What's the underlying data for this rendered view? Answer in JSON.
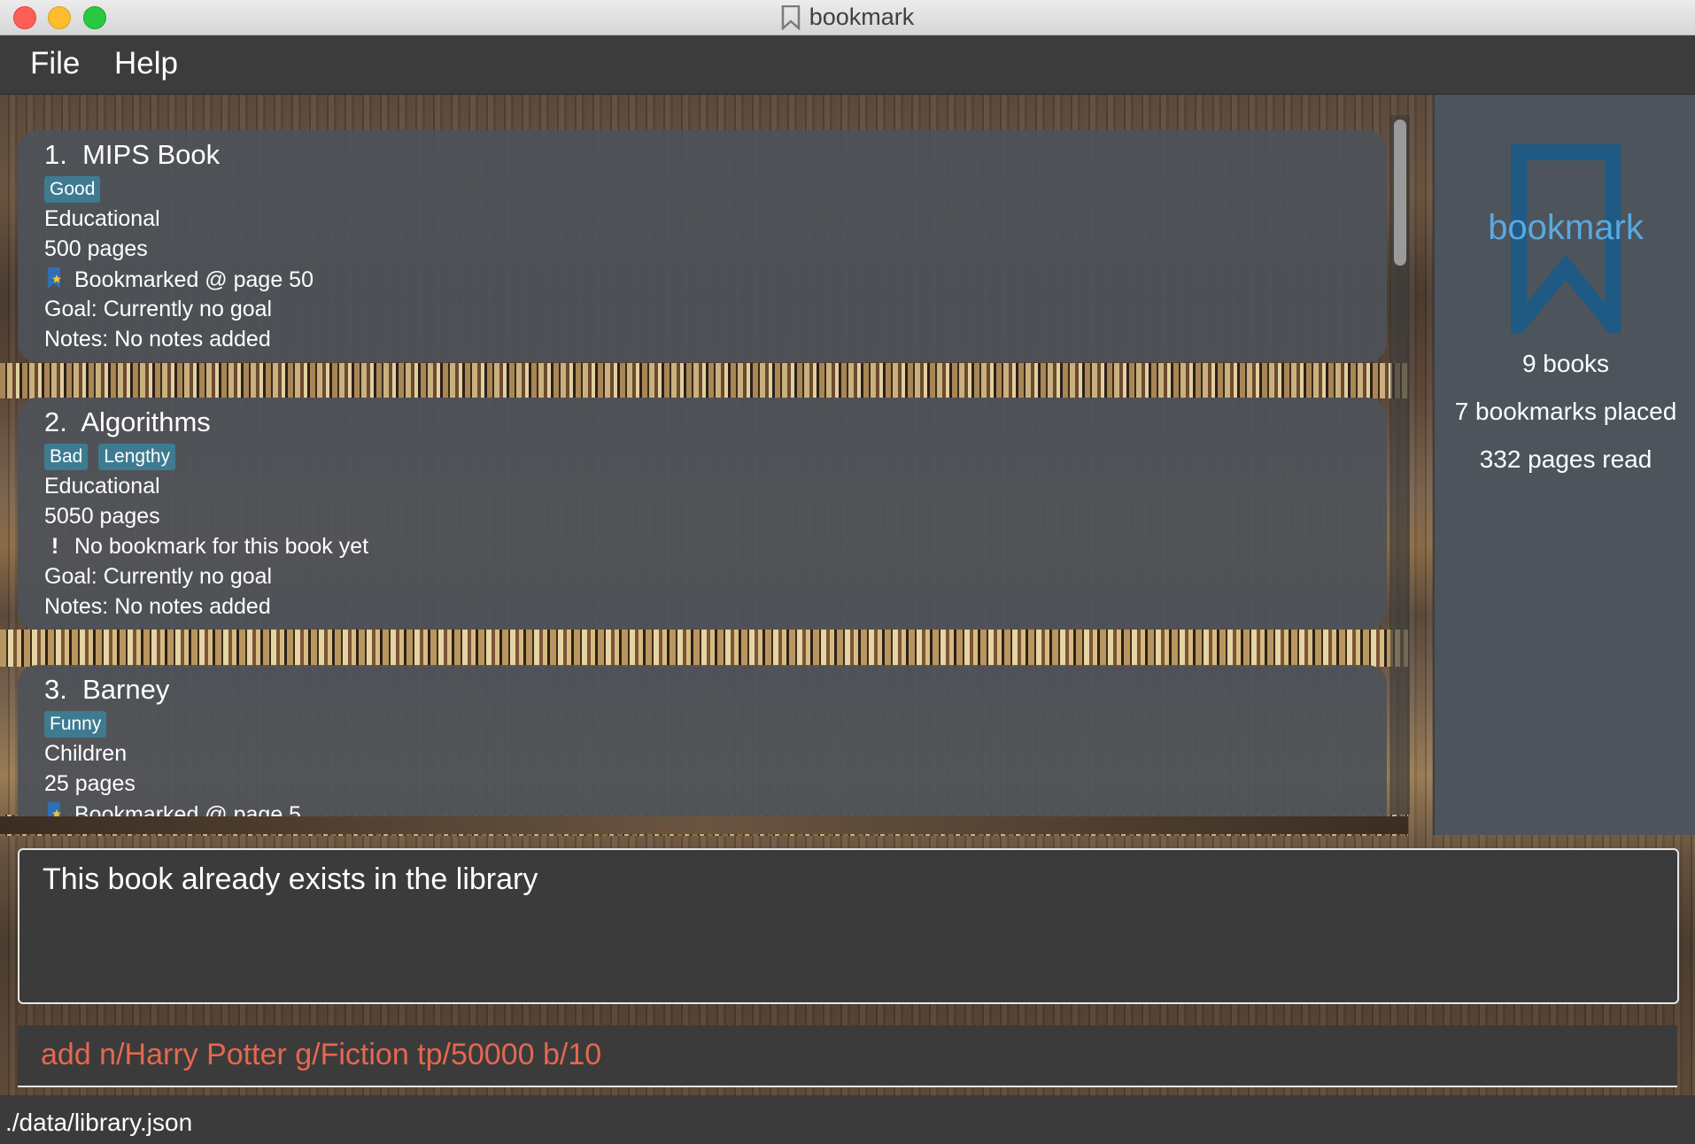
{
  "window": {
    "title": "bookmark"
  },
  "menu": {
    "items": [
      "File",
      "Help"
    ]
  },
  "books": [
    {
      "index": "1.",
      "name": "MIPS Book",
      "tags": [
        "Good"
      ],
      "genre": "Educational",
      "pages": "500 pages",
      "bookmark": "Bookmarked @ page 50",
      "has_bookmark": true,
      "goal": "Goal: Currently no goal",
      "notes": "Notes: No notes added"
    },
    {
      "index": "2.",
      "name": "Algorithms",
      "tags": [
        "Bad",
        "Lengthy"
      ],
      "genre": "Educational",
      "pages": "5050 pages",
      "bookmark": "No bookmark for this book yet",
      "has_bookmark": false,
      "goal": "Goal: Currently no goal",
      "notes": "Notes: No notes added"
    },
    {
      "index": "3.",
      "name": "Barney",
      "tags": [
        "Funny"
      ],
      "genre": "Children",
      "pages": "25 pages",
      "bookmark": "Bookmarked @ page 5",
      "has_bookmark": true
    }
  ],
  "stats": {
    "logo_text": "bookmark",
    "books": "9 books",
    "bookmarks": "7 bookmarks placed",
    "pages_read": "332 pages read"
  },
  "result": {
    "text": "This book already exists in the library"
  },
  "command": {
    "text": "add n/Harry Potter g/Fiction tp/50000 b/10"
  },
  "status": {
    "path": "./data/library.json"
  },
  "colors": {
    "accent_tag": "#3e7b91",
    "logo": "#1e5a84",
    "command_text": "#e4684f"
  }
}
